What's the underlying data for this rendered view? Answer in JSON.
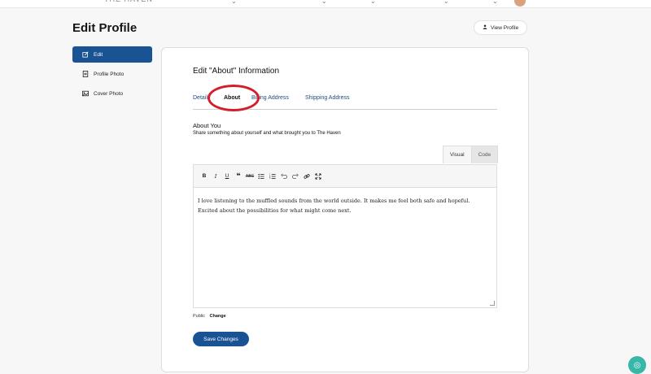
{
  "page": {
    "title": "Edit Profile",
    "view_profile_label": "View Profile"
  },
  "sidebar": {
    "items": [
      {
        "label": "Edit",
        "icon": "edit-icon",
        "active": true
      },
      {
        "label": "Profile Photo",
        "icon": "profile-photo-icon",
        "active": false
      },
      {
        "label": "Cover Photo",
        "icon": "cover-photo-icon",
        "active": false
      }
    ]
  },
  "card": {
    "title": "Edit \"About\" Information",
    "tabs": [
      {
        "label": "Details",
        "active": false
      },
      {
        "label": "About",
        "active": true
      },
      {
        "label": "Billing Address",
        "active": false
      },
      {
        "label": "Shipping Address",
        "active": false
      }
    ],
    "about_label": "About You",
    "about_hint": "Share something about yourself and what brought you to The Haven",
    "editor_tabs": {
      "visual": "Visual",
      "code": "Code"
    },
    "toolbar": [
      "bold-icon",
      "italic-icon",
      "underline-icon",
      "blockquote-icon",
      "strikethrough-icon",
      "bullet-list-icon",
      "numbered-list-icon",
      "undo-icon",
      "redo-icon",
      "link-icon",
      "fullscreen-icon"
    ],
    "editor_text_line1": "I love listening to the muffled sounds from the world outside. It makes me feel both safe and hopeful.",
    "editor_text_line2": "Excited about the possibilities for what might come next.",
    "privacy_label": "Public",
    "privacy_change": "Change",
    "save_label": "Save Changes"
  },
  "colors": {
    "accent": "#1a5394",
    "highlight": "#d41f2a",
    "fab": "#38b6a8"
  }
}
